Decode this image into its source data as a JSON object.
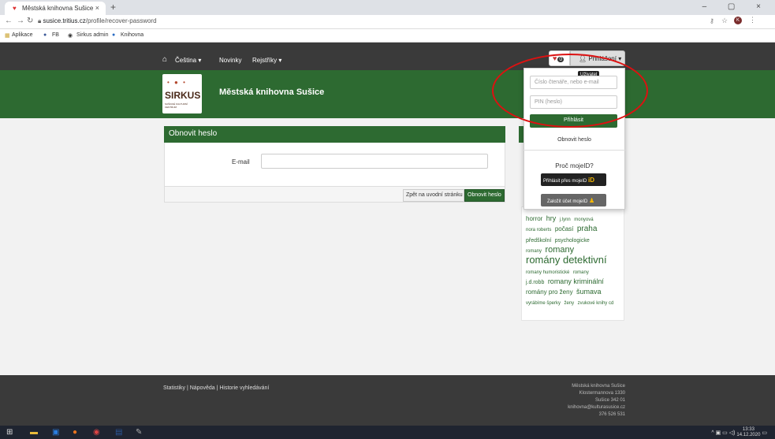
{
  "browser": {
    "tab_title": "Městská knihovna Sušice",
    "tab_close": "×",
    "new_tab": "+",
    "url_host": "susice.tritius.cz",
    "url_path": "/profile/recover-password",
    "window_controls": "– ▢ ×",
    "bookmarks": [
      "Aplikace",
      "FB",
      "Sirkus admin",
      "Knihovna"
    ]
  },
  "topnav": {
    "language": "Čeština ▾",
    "news": "Novinky",
    "registers": "Rejstříky ▾",
    "heart_count": "0",
    "login": "Přihlášení ▾"
  },
  "header": {
    "library_name": "Městská knihovna Sušice",
    "logo_text": "SIRKUS",
    "logo_subtext": "SUŠICKÉ KULTURNÍ CENTRUM"
  },
  "recover": {
    "title": "Obnovit heslo",
    "email_label": "E-mail",
    "back_button": "Zpět na uvodní stránku",
    "submit_button": "Obnovit heslo"
  },
  "dropdown": {
    "tooltip": "Uživatel",
    "reader_placeholder": "Číslo čtenáře, nebo e-mail",
    "pin_placeholder": "PIN (heslo)",
    "login_button": "Přihlásit",
    "recover_link": "Obnovit heslo",
    "why_mojeid": "Proč mojeID?",
    "login_mojeid": "Přihlásit přes mojeID",
    "create_mojeid": "Založit účet mojeID"
  },
  "tags": [
    "horror",
    "hry",
    "j.lynn",
    "monyová",
    "nora roberts",
    "počasí",
    "praha",
    "předškolní",
    "psychologicke",
    "romany",
    "romany",
    "romány detektivní",
    "romany humoristické",
    "romany",
    "j.d.robb",
    "romany kriminální",
    "romány pro ženy",
    "šumava",
    "vyrábíme šperky",
    "ženy",
    "zvukové knihy cd"
  ],
  "footer": {
    "links": "Statistiky | Nápověda | Historie vyhledávání",
    "address": [
      "Městská knihovna Sušice",
      "Klostermannova 1330",
      "Sušice 342 01",
      "knihovna@kulturasusice.cz",
      "376 526 531"
    ]
  },
  "taskbar": {
    "time": "13:33",
    "date": "14.12.2020"
  }
}
